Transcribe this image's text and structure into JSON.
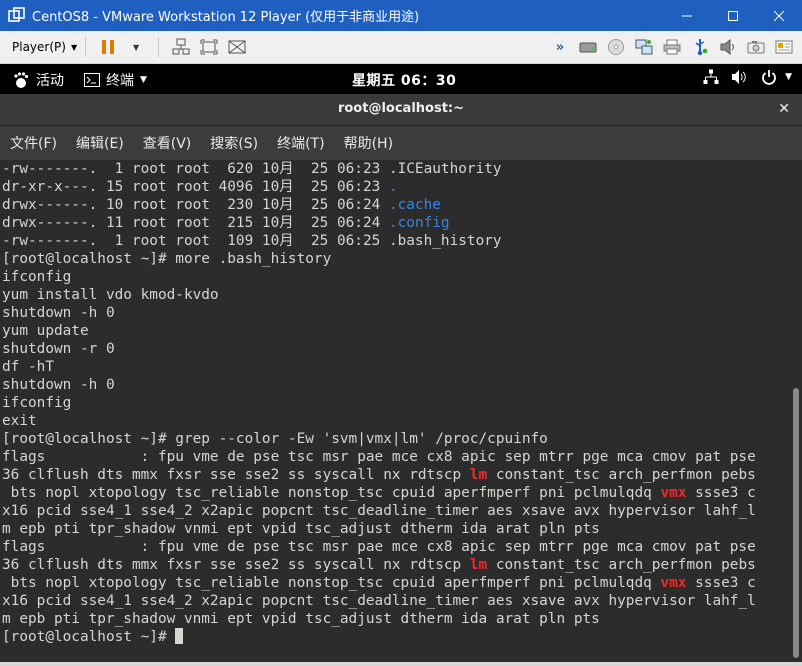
{
  "vmware": {
    "title": "CentOS8 - VMware Workstation 12 Player (仅用于非商业用途)",
    "player_menu": "Player(P)"
  },
  "gnome": {
    "activities": "活动",
    "terminal_app": "终端",
    "clock": "星期五 06：30"
  },
  "terminal": {
    "title": "root@localhost:~",
    "menus": [
      "文件(F)",
      "编辑(E)",
      "查看(V)",
      "搜索(S)",
      "终端(T)",
      "帮助(H)"
    ],
    "lines": [
      [
        {
          "t": "-rw-------.  1 root root  620 10月  25 06:23 .ICEauthority"
        }
      ],
      [
        {
          "t": "dr-xr-x---. 15 root root 4096 10月  25 06:23 "
        },
        {
          "t": ".",
          "c": "dir"
        }
      ],
      [
        {
          "t": "drwx------. 10 root root  230 10月  25 06:24 "
        },
        {
          "t": ".cache",
          "c": "dir"
        }
      ],
      [
        {
          "t": "drwx------. 11 root root  215 10月  25 06:24 "
        },
        {
          "t": ".config",
          "c": "dir"
        }
      ],
      [
        {
          "t": "-rw-------.  1 root root  109 10月  25 06:25 .bash_history"
        }
      ],
      [
        {
          "t": "[root@localhost ~]# more .bash_history"
        }
      ],
      [
        {
          "t": "ifconfig"
        }
      ],
      [
        {
          "t": "yum install vdo kmod-kvdo"
        }
      ],
      [
        {
          "t": "shutdown -h 0"
        }
      ],
      [
        {
          "t": "yum update"
        }
      ],
      [
        {
          "t": "shutdown -r 0"
        }
      ],
      [
        {
          "t": "df -hT"
        }
      ],
      [
        {
          "t": "shutdown -h 0"
        }
      ],
      [
        {
          "t": "ifconfig"
        }
      ],
      [
        {
          "t": "exit"
        }
      ],
      [
        {
          "t": "[root@localhost ~]# grep --color -Ew 'svm|vmx|lm' /proc/cpuinfo"
        }
      ],
      [
        {
          "t": "flags           : fpu vme de pse tsc msr pae mce cx8 apic sep mtrr pge mca cmov pat pse"
        }
      ],
      [
        {
          "t": "36 clflush dts mmx fxsr sse sse2 ss syscall nx rdtscp "
        },
        {
          "t": "lm",
          "c": "hl"
        },
        {
          "t": " constant_tsc arch_perfmon pebs"
        }
      ],
      [
        {
          "t": " bts nopl xtopology tsc_reliable nonstop_tsc cpuid aperfmperf pni pclmulqdq "
        },
        {
          "t": "vmx",
          "c": "hl"
        },
        {
          "t": " ssse3 c"
        }
      ],
      [
        {
          "t": "x16 pcid sse4_1 sse4_2 x2apic popcnt tsc_deadline_timer aes xsave avx hypervisor lahf_l"
        }
      ],
      [
        {
          "t": "m epb pti tpr_shadow vnmi ept vpid tsc_adjust dtherm ida arat pln pts"
        }
      ],
      [
        {
          "t": "flags           : fpu vme de pse tsc msr pae mce cx8 apic sep mtrr pge mca cmov pat pse"
        }
      ],
      [
        {
          "t": "36 clflush dts mmx fxsr sse sse2 ss syscall nx rdtscp "
        },
        {
          "t": "lm",
          "c": "hl"
        },
        {
          "t": " constant_tsc arch_perfmon pebs"
        }
      ],
      [
        {
          "t": " bts nopl xtopology tsc_reliable nonstop_tsc cpuid aperfmperf pni pclmulqdq "
        },
        {
          "t": "vmx",
          "c": "hl"
        },
        {
          "t": " ssse3 c"
        }
      ],
      [
        {
          "t": "x16 pcid sse4_1 sse4_2 x2apic popcnt tsc_deadline_timer aes xsave avx hypervisor lahf_l"
        }
      ],
      [
        {
          "t": "m epb pti tpr_shadow vnmi ept vpid tsc_adjust dtherm ida arat pln pts"
        }
      ],
      [
        {
          "t": "[root@localhost ~]# "
        },
        {
          "cursor": true
        }
      ]
    ]
  },
  "colors": {
    "vmware_titlebar": "#1f5fbf",
    "terminal_bg": "#2c2c2c",
    "terminal_fg": "#d3d7cf",
    "directory": "#3584e4",
    "grep_match": "#ef2929"
  }
}
